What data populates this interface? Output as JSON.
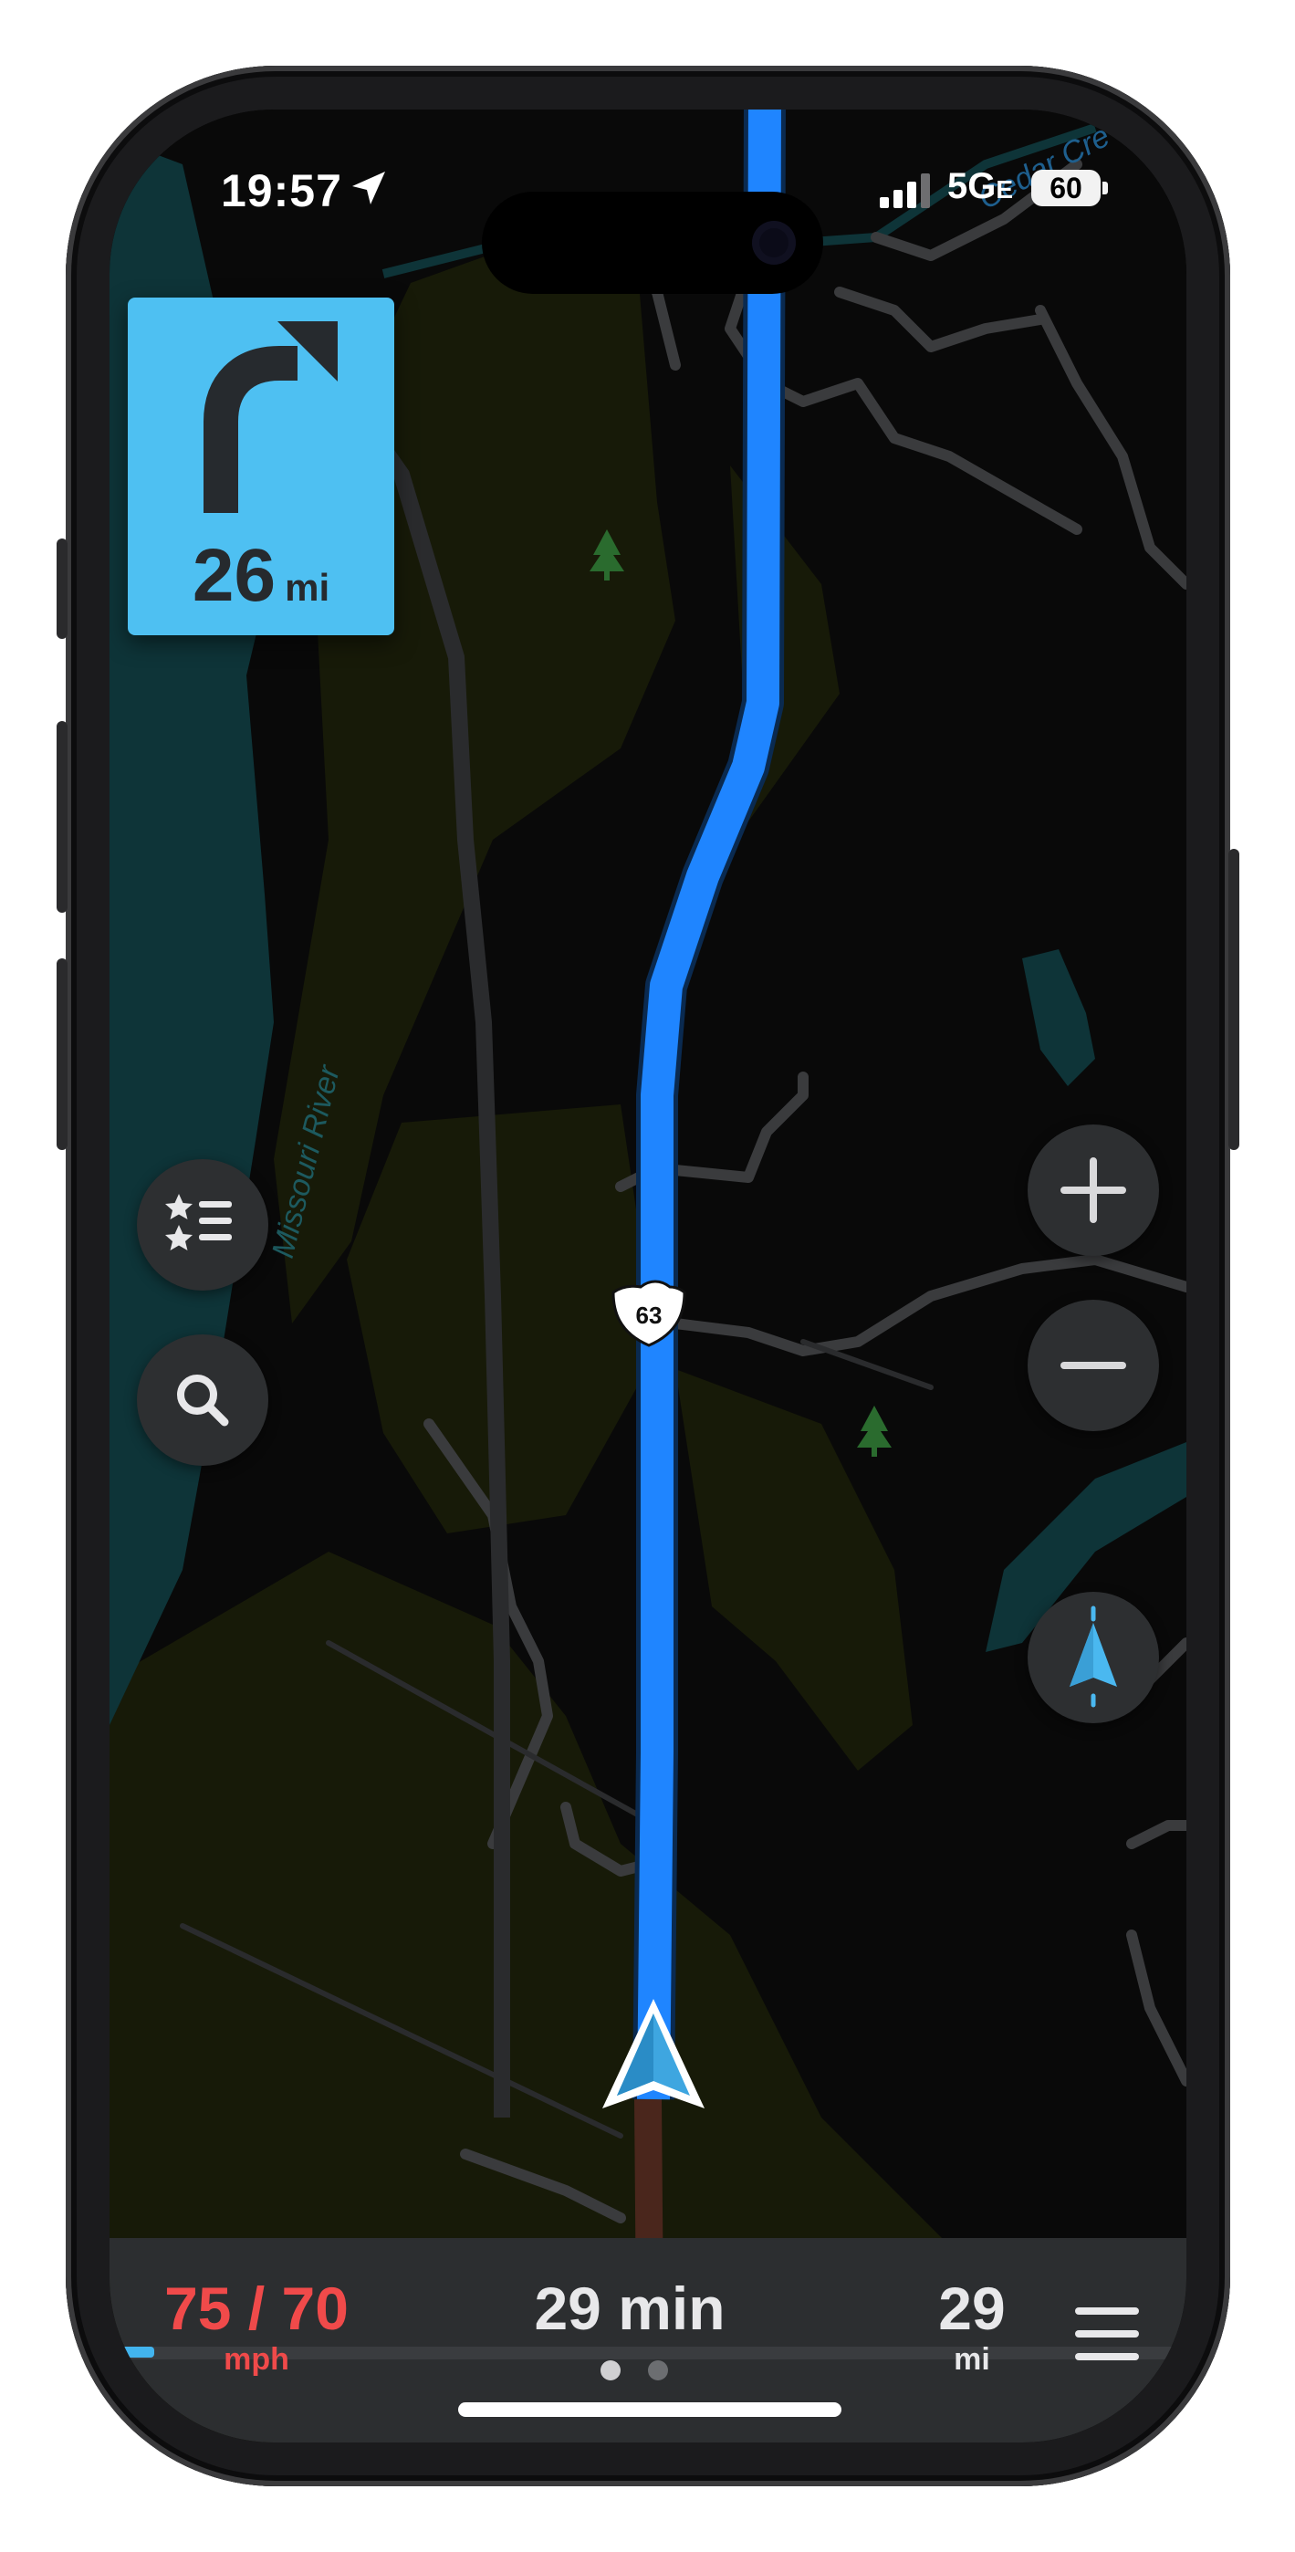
{
  "status_bar": {
    "time": "19:57",
    "network": "5G",
    "network_suffix": "E",
    "battery": "60"
  },
  "map": {
    "labels": {
      "river": "Missouri River",
      "creek": "Cedar Cre",
      "route_shield": "63"
    },
    "colors": {
      "route": "#1f85ff",
      "water": "#0e3438",
      "park": "#171a08",
      "road": "#3a3b3d"
    }
  },
  "maneuver": {
    "icon": "turn-right-icon",
    "distance": "26",
    "unit": "mi",
    "background": "#4ec0f2"
  },
  "controls": {
    "favorites_icon": "favorites-list-icon",
    "search_icon": "search-icon",
    "zoom_in_icon": "plus-icon",
    "zoom_out_icon": "minus-icon",
    "recenter_icon": "compass-arrow-icon"
  },
  "bottom_bar": {
    "speed": "75 / 70",
    "speed_unit": "mph",
    "eta": "29 min",
    "page_dots": 2,
    "active_dot": 0,
    "distance": "29",
    "distance_unit": "mi",
    "trip_progress": 0.035,
    "speed_color": "#f04a4a",
    "progress_color": "#42b4ee",
    "menu_icon": "hamburger-menu-icon"
  }
}
